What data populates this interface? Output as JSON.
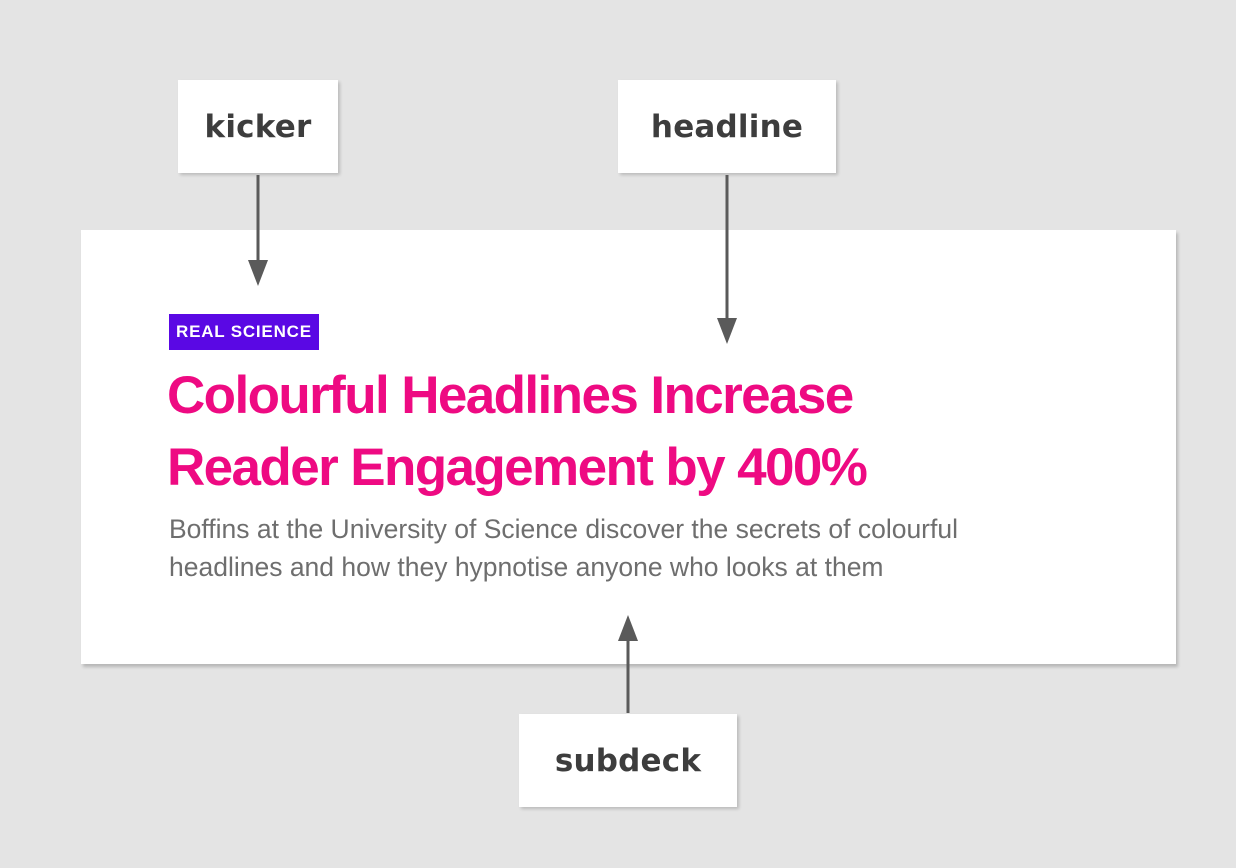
{
  "labels": {
    "kicker": "kicker",
    "headline": "headline",
    "subdeck": "subdeck"
  },
  "article": {
    "kicker": "REAL SCIENCE",
    "headline": "Colourful Headlines Increase Reader Engagement by 400%",
    "subdeck": "Boffins at the University of Science discover the secrets of colourful headlines and how they hypnotise anyone who looks at them"
  },
  "colors": {
    "background": "#e4e4e4",
    "card": "#ffffff",
    "kicker_bg": "#5a08e4",
    "headline": "#ee0a82",
    "subdeck": "#6e6e6e",
    "arrow": "#5a5a5a",
    "label_text": "#3d3d3d"
  }
}
